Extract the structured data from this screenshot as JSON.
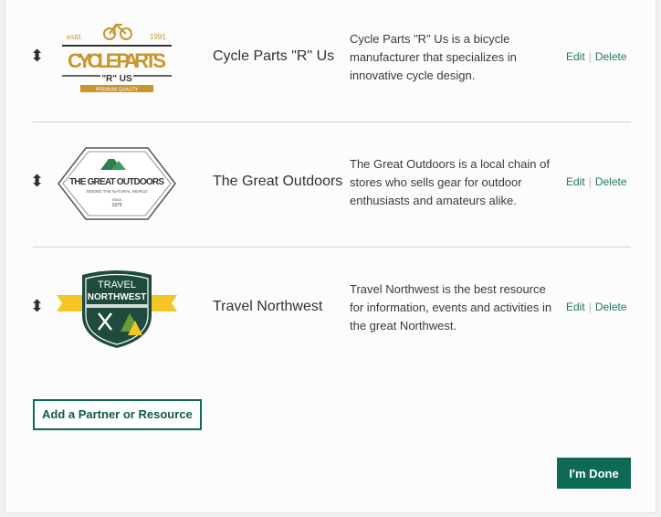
{
  "partners": [
    {
      "name": "Cycle Parts \"R\" Us",
      "description": "Cycle Parts \"R\" Us is a bicycle manufacturer that specializes in innovative cycle design.",
      "logo": {
        "estd": "estd.",
        "year": "1991",
        "line1": "CYCLE PARTS",
        "line2": "\"R\" US",
        "tagline": "PREMIUM QUALITY",
        "icon": "bicycle-icon",
        "color": "#c9962e"
      }
    },
    {
      "name": "The Great Outdoors",
      "description": "The Great Outdoors is a local chain of stores who sells gear for outdoor enthusiasts and amateurs alike.",
      "logo": {
        "title": "THE GREAT OUTDOORS",
        "tagline": "SEEING THE NATURAL WORLD",
        "since": "SINCE",
        "year": "1975",
        "icon": "mountain-icon",
        "color": "#2e7d4f"
      }
    },
    {
      "name": "Travel Northwest",
      "description": "Travel Northwest is the best resource for information, events and activities in the great Northwest.",
      "logo": {
        "line1": "TRAVEL",
        "line2": "NORTHWEST",
        "icon": "crossed-axes-icon",
        "color": "#1f4a3e",
        "accent": "#f3c623"
      }
    }
  ],
  "actions": {
    "edit": "Edit",
    "separator": "|",
    "delete": "Delete"
  },
  "handle_glyph": "⬍",
  "buttons": {
    "add": "Add a Partner or Resource",
    "done": "I'm Done"
  }
}
